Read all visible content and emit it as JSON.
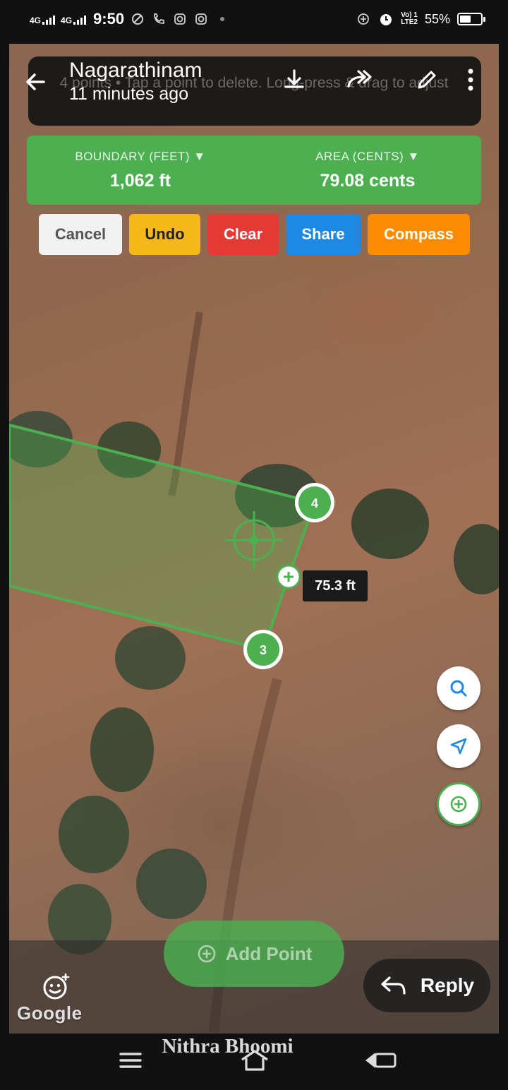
{
  "status_bar": {
    "net1": "4G",
    "net2": "4G",
    "time": "9:50",
    "lte_top": "Vo) 1",
    "lte_bottom": "LTE2",
    "battery": "55%",
    "battery_level": 0.55
  },
  "header": {
    "title": "Nagarathinam",
    "subtitle": "11 minutes ago",
    "hint": "4 points • Tap a point to delete. Long-press & drag to adjust",
    "icons": [
      "back-arrow-icon",
      "download-icon",
      "forward-icon",
      "edit-pencil-icon",
      "more-vert-icon"
    ]
  },
  "measure": {
    "boundary_label": "BOUNDARY (FEET) ▼",
    "boundary_value": "1,062 ft",
    "area_label": "AREA (CENTS) ▼",
    "area_value": "79.08 cents"
  },
  "actions": {
    "cancel": "Cancel",
    "undo": "Undo",
    "clear": "Clear",
    "share": "Share",
    "compass": "Compass"
  },
  "map": {
    "points": [
      {
        "label": "4"
      },
      {
        "label": "3"
      }
    ],
    "segment_length": "75.3 ft",
    "colors": {
      "polygon": "#4caf50",
      "fill": "rgba(76,175,80,0.35)"
    }
  },
  "fabs": [
    "search-icon",
    "navigation-icon",
    "add-location-icon"
  ],
  "add_point": "Add Point",
  "google": "Google",
  "reply": "Reply",
  "watermark": "Nithra Bhoomi"
}
